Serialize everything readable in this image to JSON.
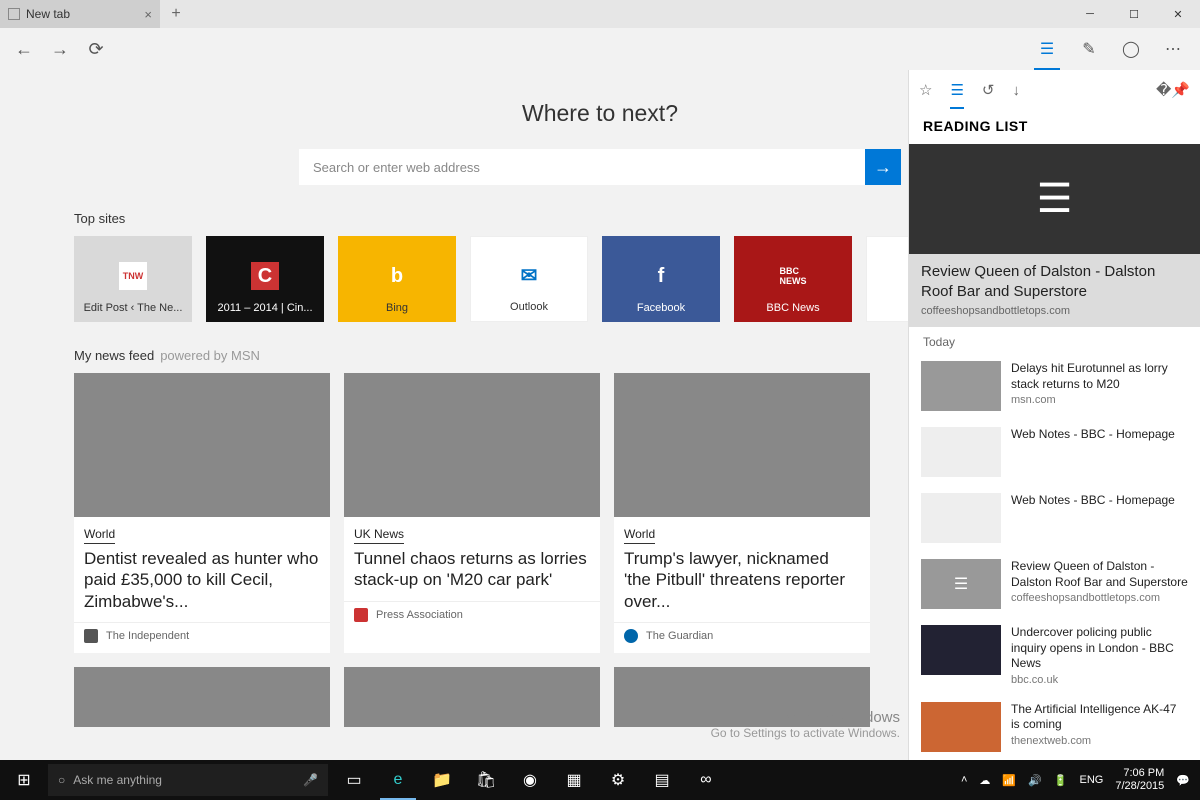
{
  "window": {
    "tab_title": "New tab"
  },
  "hero": {
    "title": "Where to next?",
    "search_placeholder": "Search or enter web address"
  },
  "sections": {
    "top_sites": "Top sites",
    "news_feed": "My news feed",
    "news_sub": "powered by MSN"
  },
  "tiles": [
    {
      "label": "Edit Post ‹ The Ne...",
      "bg": "t0"
    },
    {
      "label": "2011 – 2014 | Cin...",
      "bg": "t1"
    },
    {
      "label": "Bing",
      "bg": "t2"
    },
    {
      "label": "Outlook",
      "bg": "t3"
    },
    {
      "label": "Facebook",
      "bg": "t4"
    },
    {
      "label": "BBC News",
      "bg": "t5"
    }
  ],
  "news": [
    {
      "cat": "World",
      "headline": "Dentist revealed as hunter who paid £35,000 to kill Cecil, Zimbabwe's...",
      "source": "The Independent"
    },
    {
      "cat": "UK News",
      "headline": "Tunnel chaos returns as lorries stack-up on 'M20 car park'",
      "source": "Press Association"
    },
    {
      "cat": "World",
      "headline": "Trump's lawyer, nicknamed 'the Pitbull' threatens reporter over...",
      "source": "The Guardian"
    }
  ],
  "panel": {
    "title": "READING LIST",
    "hero": {
      "title": "Review Queen of Dalston - Dalston Roof Bar and Superstore",
      "source": "coffeeshopsandbottletops.com"
    },
    "day": "Today",
    "items": [
      {
        "title": "Delays hit Eurotunnel as lorry stack returns to M20",
        "source": "msn.com"
      },
      {
        "title": "Web Notes - BBC - Homepage",
        "source": ""
      },
      {
        "title": "Web Notes - BBC - Homepage",
        "source": ""
      },
      {
        "title": "Review Queen of Dalston - Dalston Roof Bar and Superstore",
        "source": "coffeeshopsandbottletops.com"
      },
      {
        "title": "Undercover policing public inquiry opens in London - BBC News",
        "source": "bbc.co.uk"
      },
      {
        "title": "The Artificial Intelligence AK-47 is coming",
        "source": "thenextweb.com"
      }
    ]
  },
  "taskbar": {
    "search_placeholder": "Ask me anything",
    "lang": "ENG",
    "time": "7:06 PM",
    "date": "7/28/2015"
  },
  "watermark": {
    "line1": "Activate Windows",
    "line2": "Go to Settings to activate Windows."
  }
}
